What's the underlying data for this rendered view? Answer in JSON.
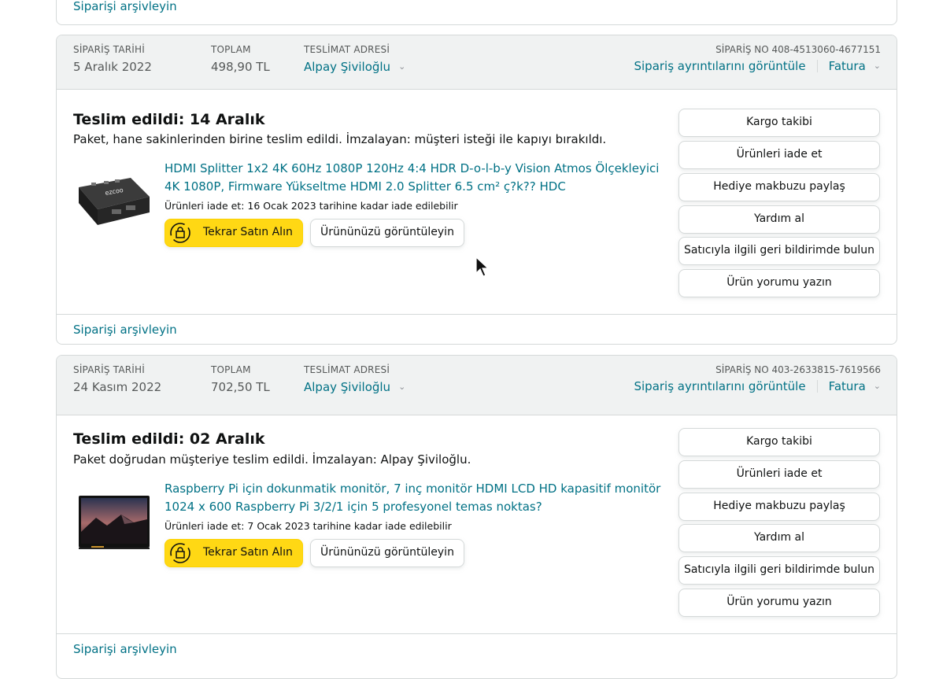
{
  "archive_label": "Siparişi arşivleyin",
  "labels": {
    "order_date": "SİPARİŞ TARİHİ",
    "total": "TOPLAM",
    "ship_to": "TESLİMAT ADRESİ",
    "order_no_prefix": "SİPARİŞ NO",
    "view_details": "Sipariş ayrıntılarını görüntüle",
    "invoice": "Fatura",
    "buy_again": "Tekrar Satın Alın",
    "view_product": "Ürününüzü görüntüleyin"
  },
  "side_buttons": [
    "Kargo takibi",
    "Ürünleri iade et",
    "Hediye makbuzu paylaş",
    "Yardım al",
    "Satıcıyla ilgili geri bildirimde bulun",
    "Ürün yorumu yazın"
  ],
  "orders": [
    {
      "date": "5 Aralık 2022",
      "total": "498,90 TL",
      "ship_to": "Alpay Şiviloğlu",
      "order_no": "SİPARİŞ NO 408-4513060-4677151",
      "status": "Teslim edildi: 14 Aralık",
      "status_detail": "Paket, hane sakinlerinden birine teslim edildi. İmzalayan: müşteri isteği ile kapıyı bırakıldı.",
      "product_title": "HDMI Splitter 1x2 4K 60Hz 1080P 120Hz 4:4 HDR D-o-l-b-y Vision Atmos Ölçekleyici 4K 1080P, Firmware Yükseltme HDMI 2.0 Splitter 6.5 cm² ç?k?? HDC",
      "return_note": "Ürünleri iade et: 16 Ocak 2023 tarihine kadar iade edilebilir",
      "thumb_brand": "ezcoo"
    },
    {
      "date": "24 Kasım 2022",
      "total": "702,50 TL",
      "ship_to": "Alpay Şiviloğlu",
      "order_no": "SİPARİŞ NO 403-2633815-7619566",
      "status": "Teslim edildi: 02 Aralık",
      "status_detail": "Paket doğrudan müşteriye teslim edildi. İmzalayan: Alpay Şiviloğlu.",
      "product_title": "Raspberry Pi için dokunmatik monitör, 7 inç monitör HDMI LCD HD kapasitif monitör 1024 x 600 Raspberry Pi 3/2/1 için 5 profesyonel temas noktas?",
      "return_note": "Ürünleri iade et: 7 Ocak 2023 tarihine kadar iade edilebilir"
    }
  ]
}
